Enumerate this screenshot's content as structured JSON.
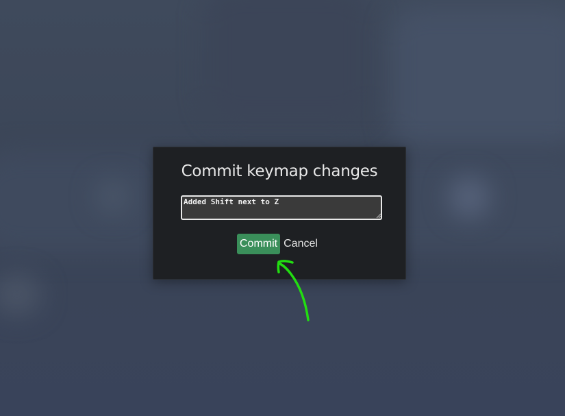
{
  "dialog": {
    "title": "Commit keymap changes",
    "message_value": "Added Shift next to Z",
    "commit_label": "Commit",
    "cancel_label": "Cancel"
  },
  "annotation": {
    "arrow_color": "#22dd11",
    "points_to": "commit-button"
  },
  "colors": {
    "dialog_background": "#1e2023",
    "commit_button": "#3a8f5a",
    "page_background": "#3a4456"
  }
}
